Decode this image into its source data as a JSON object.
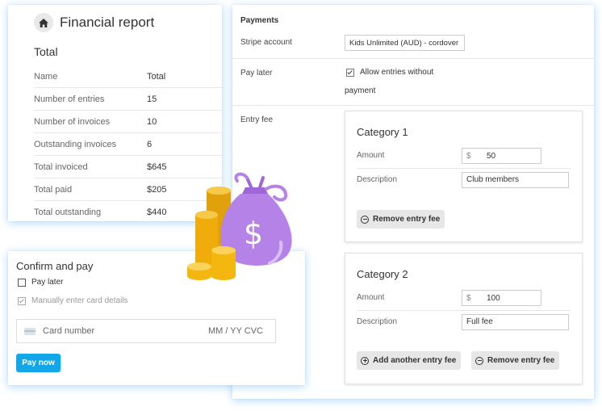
{
  "financial_report": {
    "title": "Financial report",
    "icon": "home-icon",
    "subtitle": "Total",
    "columns": [
      "Name",
      "Total"
    ],
    "rows": [
      {
        "name": "Number of entries",
        "value": "15"
      },
      {
        "name": "Number of invoices",
        "value": "10"
      },
      {
        "name": "Outstanding invoices",
        "value": "6"
      },
      {
        "name": "Total invoiced",
        "value": "$645"
      },
      {
        "name": "Total paid",
        "value": "$205"
      },
      {
        "name": "Total outstanding",
        "value": "$440"
      }
    ]
  },
  "confirm_pay": {
    "title": "Confirm and pay",
    "pay_later_label": "Pay later",
    "pay_later_checked": false,
    "manual_card_label": "Manually enter card details",
    "manual_card_checked": true,
    "card_number_placeholder": "Card number",
    "card_expiry_cvc_placeholder": "MM / YY  CVC",
    "pay_button": "Pay now",
    "pay_button_color": "#13a6e8"
  },
  "payments": {
    "title": "Payments",
    "stripe_label": "Stripe account",
    "stripe_value": "Kids Unlimited (AUD) - cordover",
    "pay_later_label": "Pay later",
    "allow_label_line1": "Allow entries without",
    "allow_label_line2": "payment",
    "allow_checked": true,
    "entry_fee_label": "Entry fee",
    "categories": [
      {
        "title": "Category 1",
        "amount_label": "Amount",
        "currency": "$",
        "amount": "50",
        "description_label": "Description",
        "description": "Club members",
        "remove_button": "Remove entry fee"
      },
      {
        "title": "Category 2",
        "amount_label": "Amount",
        "currency": "$",
        "amount": "100",
        "description_label": "Description",
        "description": "Full fee",
        "add_button": "Add another entry fee",
        "remove_button": "Remove entry fee"
      }
    ]
  },
  "illustration": {
    "icon": "money-bag-icon",
    "bag_color": "#b583e8",
    "coin_color": "#f2b514",
    "symbol": "$"
  }
}
